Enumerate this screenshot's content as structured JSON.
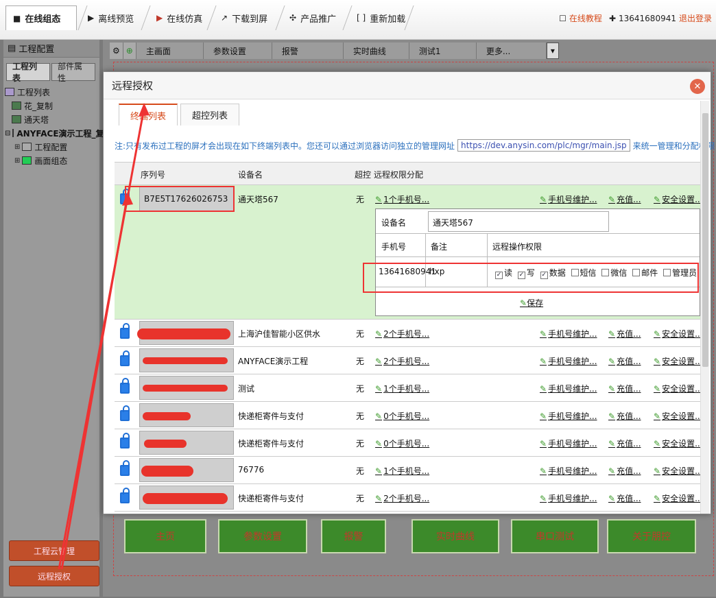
{
  "toolbar": {
    "tabs": [
      {
        "label": "在线组态",
        "icon": "■"
      },
      {
        "label": "离线预览",
        "icon": "▶"
      },
      {
        "label": "在线仿真",
        "icon": "▶"
      },
      {
        "label": "下载到屏",
        "icon": "↗"
      },
      {
        "label": "产品推广",
        "icon": "✣"
      },
      {
        "label": "重新加载",
        "icon": "[ ]"
      }
    ],
    "tutorial": "在线教程",
    "phone": "13641680941",
    "logout": "退出登录"
  },
  "left": {
    "title": "工程配置",
    "tabs": [
      "工程列表",
      "部件属性"
    ],
    "tree": [
      "工程列表",
      "花_复制",
      "通天塔",
      "ANYFACE演示工程_复",
      "工程配置",
      "画面组态"
    ],
    "buttons": [
      "工程云管理",
      "远程授权"
    ]
  },
  "canvas": {
    "tabs": [
      "主画面",
      "参数设置",
      "报警",
      "实时曲线",
      "测试1",
      "更多..."
    ],
    "buttons": [
      "主页",
      "参数设置",
      "报警",
      "实时曲线",
      "串口测试",
      "关于朋控"
    ]
  },
  "modal": {
    "title": "远程授权",
    "tabs": [
      "终端列表",
      "超控列表"
    ],
    "note_pre": "注:只有发布过工程的屏才会出现在如下终端列表中。您还可以通过浏览器访问独立的管理网址",
    "note_url": "https://dev.anysin.com/plc/mgr/main.jsp",
    "note_post": "来统一管理和分配权限",
    "headers": {
      "serial": "序列号",
      "device": "设备名",
      "override": "超控",
      "perm": "远程权限分配"
    },
    "link_labels": {
      "maint": "手机号维护...",
      "recharge": "充值...",
      "security": "安全设置..."
    },
    "rows": [
      {
        "serial": "B7E5T17626026753",
        "device": "通天塔567",
        "override": "无",
        "phones": "1个手机号..."
      },
      {
        "serial": "",
        "device": "上海沪佳智能小区供水",
        "override": "无",
        "phones": "2个手机号..."
      },
      {
        "serial": "",
        "device": "ANYFACE演示工程",
        "override": "无",
        "phones": "2个手机号..."
      },
      {
        "serial": "",
        "device": "测试",
        "override": "无",
        "phones": "1个手机号..."
      },
      {
        "serial": "",
        "device": "快递柜寄件与支付",
        "override": "无",
        "phones": "0个手机号..."
      },
      {
        "serial": "",
        "device": "快递柜寄件与支付",
        "override": "无",
        "phones": "0个手机号..."
      },
      {
        "serial": "",
        "device": "76776",
        "override": "无",
        "phones": "1个手机号..."
      },
      {
        "serial": "",
        "device": "快递柜寄件与支付",
        "override": "无",
        "phones": "2个手机号..."
      }
    ],
    "detail": {
      "device_label": "设备名",
      "device_value": "通天塔567",
      "phone_label": "手机号",
      "remark_label": "备注",
      "perm_label": "远程操作权限",
      "phone": "13641680941",
      "remark": "hxp",
      "perms": [
        {
          "label": "读",
          "checked": true
        },
        {
          "label": "写",
          "checked": true
        },
        {
          "label": "数据",
          "checked": true
        },
        {
          "label": "短信",
          "checked": false
        },
        {
          "label": "微信",
          "checked": false
        },
        {
          "label": "邮件",
          "checked": false
        },
        {
          "label": "管理员",
          "checked": false
        }
      ],
      "save": "保存"
    }
  }
}
